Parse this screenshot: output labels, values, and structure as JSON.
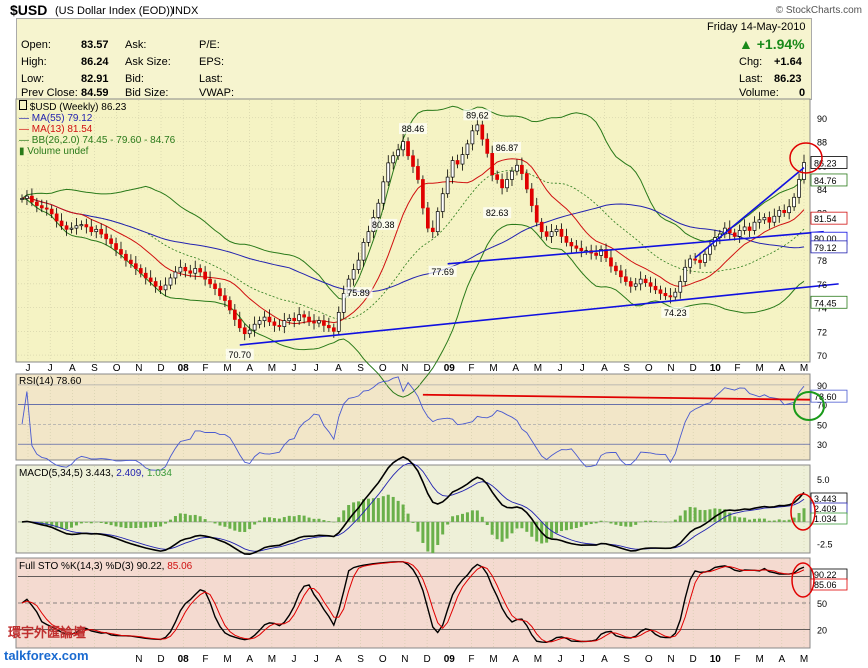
{
  "header": {
    "symbol": "$USD",
    "name": "(US Dollar Index (EOD))",
    "exchange": "INDX",
    "brand": "© StockCharts.com",
    "date": "Friday  14-May-2010"
  },
  "quote": {
    "open_label": "Open:",
    "open": "83.57",
    "high_label": "High:",
    "high": "86.24",
    "low_label": "Low:",
    "low": "82.91",
    "prev_label": "Prev Close:",
    "prev": "84.59",
    "ask_label": "Ask:",
    "asksize_label": "Ask Size:",
    "bid_label": "Bid:",
    "bidsize_label": "Bid Size:",
    "pe_label": "P/E:",
    "eps_label": "EPS:",
    "last_label2": "Last:",
    "vwap_label": "VWAP:",
    "pct_change": "+1.94%",
    "chg_label": "Chg:",
    "chg": "+1.64",
    "last_label": "Last:",
    "last": "86.23",
    "volume_label": "Volume:",
    "volume": "0"
  },
  "colors": {
    "up": "#ffffff",
    "down": "#e00000",
    "ma55": "#2323b0",
    "ma13": "#d01010",
    "bb": "#2a7a1a",
    "trend": "#1010e0",
    "panel": "#f5f3c4",
    "rsi_panel": "#f2e6c8",
    "macd_panel": "#eef0d8",
    "sto_panel": "#f4dad0"
  },
  "legend": {
    "main": "$USD (Weekly) 86.23",
    "ma55": "MA(55) 79.12",
    "ma13": "MA(13) 81.54",
    "bb": "BB(26,2.0) 74.45 - 79.60 - 84.76",
    "vol": "Volume undef",
    "rsi": "RSI(14) 78.60",
    "macd_a": "MACD(5,34,5) 3.443,",
    "macd_b": "2.409,",
    "macd_c": "1.034",
    "sto_a": "Full STO %K(14,3) %D(3) 90.22,",
    "sto_b": "85.06"
  },
  "watermark": {
    "cn": "環宇外匯論壇",
    "url": "talkforex.com"
  },
  "chart_data": [
    {
      "type": "candlestick",
      "title": "$USD (Weekly) 86.23",
      "x_months": [
        "J",
        "J",
        "A",
        "S",
        "O",
        "N",
        "D",
        "08",
        "F",
        "M",
        "A",
        "M",
        "J",
        "J",
        "A",
        "S",
        "O",
        "N",
        "D",
        "09",
        "F",
        "M",
        "A",
        "M",
        "J",
        "J",
        "A",
        "S",
        "O",
        "N",
        "D",
        "10",
        "F",
        "M",
        "A",
        "M"
      ],
      "bottom_months": [
        "N",
        "D",
        "08",
        "F",
        "M",
        "A",
        "M",
        "J",
        "J",
        "A",
        "S",
        "O",
        "N",
        "D",
        "09",
        "F",
        "M",
        "A",
        "M",
        "J",
        "J",
        "A",
        "S",
        "O",
        "N",
        "D",
        "10",
        "F",
        "M",
        "A",
        "M"
      ],
      "y_ticks": [
        "90",
        "88",
        "86",
        "84",
        "82",
        "80",
        "78",
        "76",
        "74",
        "72",
        "70"
      ],
      "ylim": [
        69.5,
        91.5
      ],
      "weekly_close": [
        83.2,
        83.4,
        82.9,
        82.6,
        82.4,
        82.3,
        81.9,
        81.3,
        80.9,
        80.6,
        80.7,
        80.9,
        81.0,
        80.8,
        80.4,
        80.6,
        80.2,
        79.8,
        79.4,
        78.9,
        78.5,
        78.0,
        77.7,
        77.3,
        76.9,
        76.5,
        76.2,
        75.8,
        75.5,
        75.9,
        76.5,
        77.0,
        77.4,
        77.1,
        76.9,
        77.3,
        77.0,
        76.4,
        76.0,
        75.6,
        75.0,
        74.6,
        73.8,
        73.0,
        72.3,
        71.8,
        72.1,
        72.6,
        72.9,
        73.2,
        72.8,
        72.5,
        72.4,
        72.9,
        73.1,
        72.9,
        73.4,
        73.2,
        72.8,
        72.7,
        72.9,
        72.5,
        72.3,
        72.0,
        73.6,
        75.2,
        76.4,
        77.2,
        78.0,
        79.5,
        80.4,
        81.6,
        82.8,
        84.6,
        86.2,
        86.8,
        87.3,
        88.0,
        86.8,
        85.9,
        84.8,
        82.4,
        80.7,
        80.4,
        82.1,
        83.6,
        85.0,
        86.4,
        86.1,
        86.9,
        87.8,
        88.9,
        89.4,
        88.2,
        87.0,
        85.2,
        84.8,
        84.1,
        84.8,
        85.5,
        86.0,
        85.3,
        84.0,
        82.6,
        81.2,
        80.4,
        80.0,
        80.4,
        80.6,
        80.0,
        79.5,
        79.2,
        79.0,
        78.8,
        78.8,
        78.6,
        78.4,
        78.9,
        78.2,
        77.5,
        77.1,
        76.6,
        76.2,
        75.8,
        76.0,
        76.4,
        76.1,
        75.8,
        75.5,
        75.2,
        75.0,
        74.9,
        75.3,
        76.2,
        77.4,
        78.1,
        78.0,
        77.8,
        78.5,
        79.2,
        79.9,
        80.2,
        80.7,
        80.3,
        80.0,
        80.5,
        80.8,
        80.5,
        81.2,
        81.4,
        81.6,
        81.2,
        81.7,
        82.2,
        82.0,
        82.5,
        83.3,
        84.8,
        86.23
      ],
      "annotations": [
        {
          "label": "70.70",
          "value": 70.7
        },
        {
          "label": "75.89",
          "value": 75.89
        },
        {
          "label": "80.38",
          "value": 80.38
        },
        {
          "label": "88.46",
          "value": 88.46
        },
        {
          "label": "77.69",
          "value": 77.69
        },
        {
          "label": "89.62",
          "value": 89.62
        },
        {
          "label": "82.63",
          "value": 82.63
        },
        {
          "label": "86.87",
          "value": 86.87
        },
        {
          "label": "74.23",
          "value": 74.23
        }
      ],
      "right_labels": [
        {
          "label": "86.23",
          "value": 86.23
        },
        {
          "label": "84.76",
          "value": 84.76
        },
        {
          "label": "81.54",
          "value": 81.54
        },
        {
          "label": "80.00",
          "value": 79.85
        },
        {
          "label": "79.12",
          "value": 79.12
        },
        {
          "label": "74.45",
          "value": 74.45
        }
      ],
      "series": [
        {
          "name": "MA(55) 79.12"
        },
        {
          "name": "MA(13) 81.54"
        },
        {
          "name": "BB(26,2.0) 74.45 - 79.60 - 84.76"
        }
      ]
    },
    {
      "type": "line",
      "title": "RSI(14) 78.60",
      "y_ticks": [
        "90",
        "70",
        "50",
        "30"
      ],
      "ylim": [
        15,
        100
      ],
      "value_label": "78.60"
    },
    {
      "type": "line",
      "title": "MACD(5,34,5) 3.443, 2.409, 1.034",
      "y_ticks": [
        "5.0",
        "2.5",
        "-2.5"
      ],
      "ylim": [
        -3.5,
        6.5
      ],
      "value_labels": [
        "3.443",
        "2.409",
        "1.034"
      ]
    },
    {
      "type": "line",
      "title": "Full STO %K(14,3) %D(3) 90.22, 85.06",
      "y_ticks": [
        "80",
        "50",
        "20"
      ],
      "ylim": [
        0,
        100
      ],
      "value_labels": [
        "90.22",
        "85.06"
      ]
    }
  ]
}
